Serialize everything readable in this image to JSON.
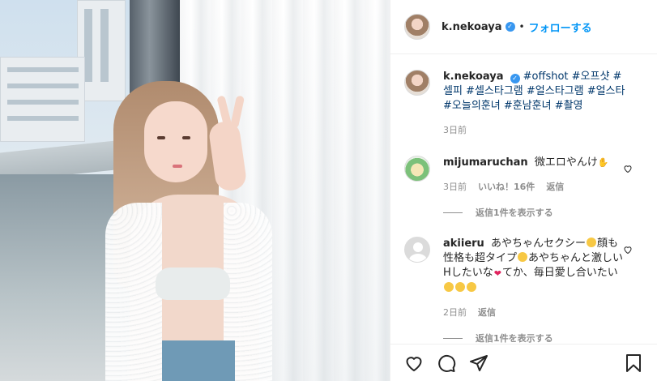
{
  "post": {
    "username": "k.nekoaya",
    "follow_label": "フォローする",
    "separator": "•"
  },
  "caption": {
    "username": "k.nekoaya",
    "text": "#offshot #오프샷 #셀피 #셀스타그램 #얼스타그램 #얼스타 #오늘의훈녀 #훈남훈녀 #촬영",
    "time": "3日前"
  },
  "comments": [
    {
      "username": "mijumaruchan",
      "text": "微エロやんけ",
      "time": "3日前",
      "likes": "いいね！16件",
      "reply_label": "返信",
      "view_replies": "返信1件を表示する"
    },
    {
      "username": "akiieru",
      "text_parts": [
        "あやちゃんセクシー",
        "顔も性格も超タイプ",
        "あやちゃんと激しいHしたいな",
        "てか、毎日愛し合いたい"
      ],
      "time": "2日前",
      "reply_label": "返信",
      "view_replies": "返信1件を表示する"
    }
  ],
  "icons": {
    "like": "heart-icon",
    "comment": "comment-icon",
    "share": "paper-plane-icon",
    "save": "bookmark-icon"
  },
  "colors": {
    "link": "#0095f6",
    "hashtag": "#00376b",
    "muted": "#8e8e8e",
    "verified": "#3897f0"
  }
}
